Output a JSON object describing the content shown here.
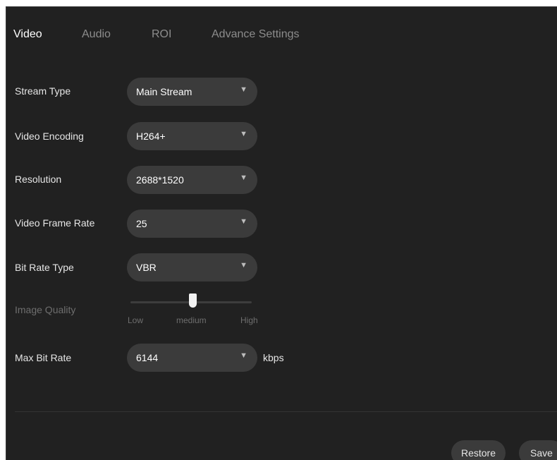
{
  "tabs": [
    {
      "label": "Video",
      "active": true
    },
    {
      "label": "Audio",
      "active": false
    },
    {
      "label": "ROI",
      "active": false
    },
    {
      "label": "Advance Settings",
      "active": false
    }
  ],
  "form": {
    "stream_type": {
      "label": "Stream Type",
      "value": "Main Stream"
    },
    "video_encoding": {
      "label": "Video Encoding",
      "value": "H264+"
    },
    "resolution": {
      "label": "Resolution",
      "value": "2688*1520"
    },
    "frame_rate": {
      "label": "Video Frame Rate",
      "value": "25"
    },
    "bit_rate_type": {
      "label": "Bit Rate Type",
      "value": "VBR"
    },
    "image_quality": {
      "label": "Image Quality",
      "disabled": true,
      "marks": {
        "low": "Low",
        "medium": "medium",
        "high": "High"
      },
      "level": 0.5
    },
    "max_bit_rate": {
      "label": "Max Bit Rate",
      "value": "6144",
      "unit": "kbps"
    }
  },
  "icons": {
    "dropdown": "caret-down-icon"
  },
  "buttons": {
    "restore": "Restore",
    "save": "Save"
  },
  "colors": {
    "background": "#212121",
    "field": "#3b3b3b",
    "text": "#e6e6e6",
    "active_tab": "#ffffff",
    "muted": "#8c8c8c"
  }
}
